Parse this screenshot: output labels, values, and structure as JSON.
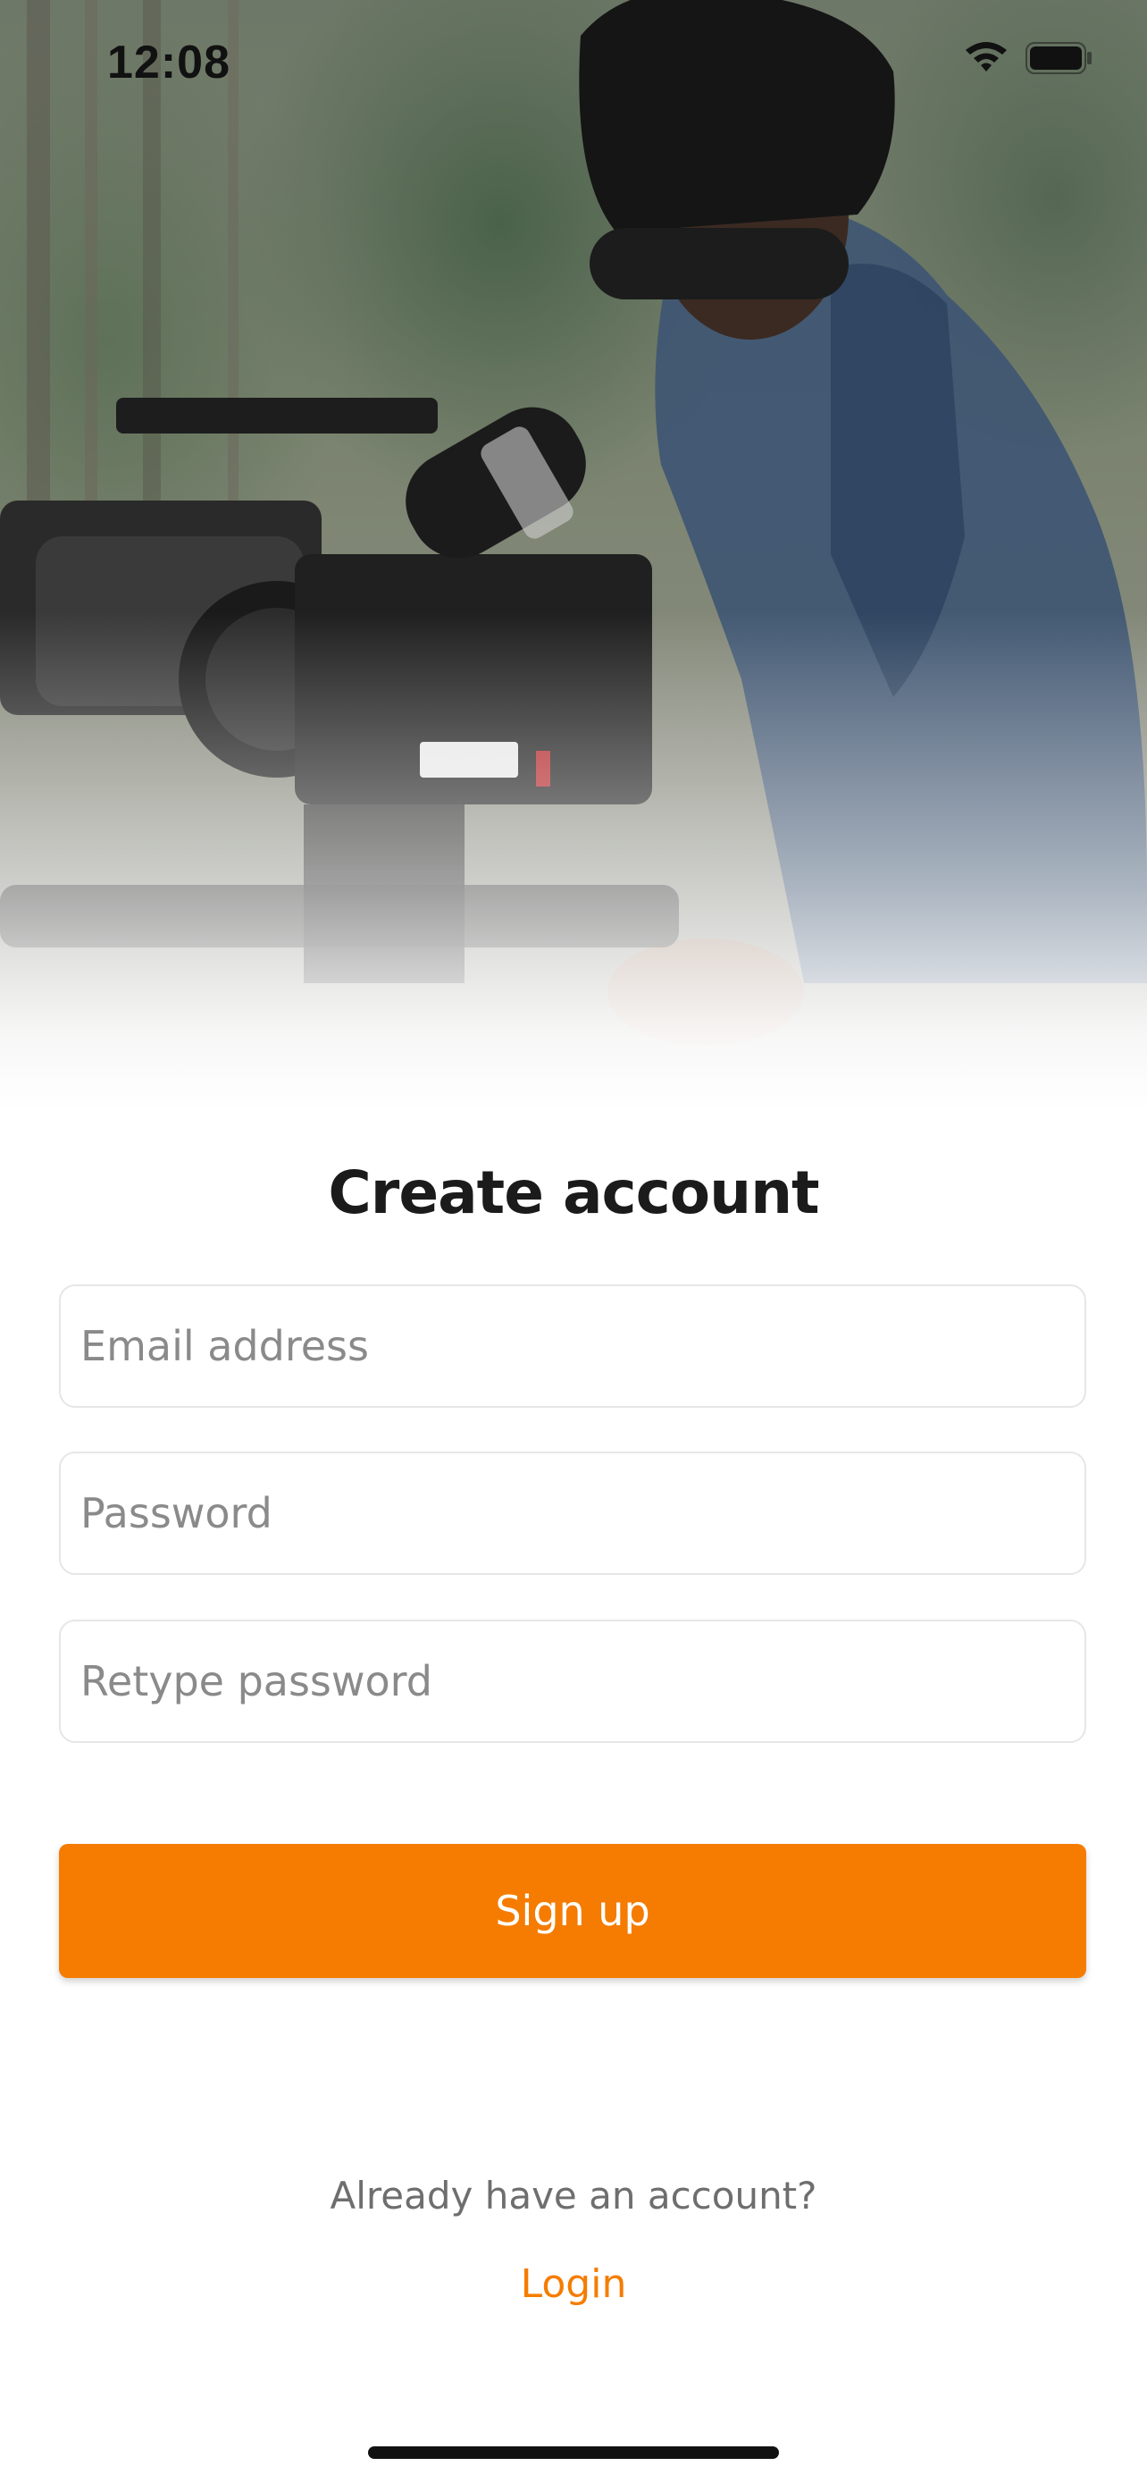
{
  "status_bar": {
    "time": "12:08"
  },
  "form": {
    "title": "Create account",
    "email_placeholder": "Email address",
    "password_placeholder": "Password",
    "retype_placeholder": "Retype password",
    "signup_label": "Sign up"
  },
  "footer": {
    "prompt": "Already have an account?",
    "login_label": "Login"
  },
  "colors": {
    "accent": "#f57c00",
    "title_text": "#1b1b1b",
    "muted_text": "#6e6e6e"
  },
  "icons": {
    "signal": "wifi-icon",
    "battery": "battery-icon"
  }
}
